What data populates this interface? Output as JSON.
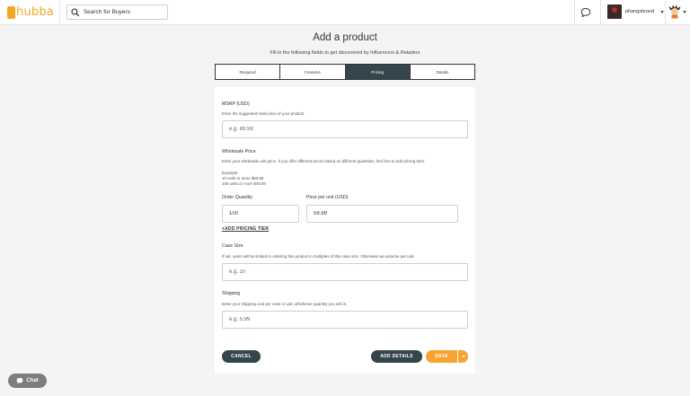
{
  "header": {
    "logo_text": "hubba",
    "search_placeholder": "Search for Buyers",
    "username": "phangsbrand"
  },
  "page": {
    "title": "Add a product",
    "subtitle": "Fill in the following fields to get discovered by Influencers & Retailers"
  },
  "tabs": [
    {
      "label": "Required",
      "active": false
    },
    {
      "label": "Features",
      "active": false
    },
    {
      "label": "Pricing",
      "active": true
    },
    {
      "label": "Details",
      "active": false
    }
  ],
  "form": {
    "msrp": {
      "label": "MSRP (USD)",
      "help": "Enter the suggested retail price of your product.",
      "placeholder": "e.g. 89.99"
    },
    "wholesale": {
      "label": "Wholesale Price",
      "help": "Enter your wholesale unit price. If you offer different prices based on different quantities, feel free to add pricing tiers.",
      "example_title": "Example:",
      "example_line1": "10 units or more $59.99",
      "example_line2": "100 units or more $49.99",
      "quantity_label": "Order Quantity",
      "quantity_value": "100",
      "price_label": "Price per unit (USD)",
      "price_value": "59.99",
      "add_tier_label": "+ADD PRICING TIER"
    },
    "case_size": {
      "label": "Case Size",
      "help": "If set, users will be limited to ordering this product in multiples of this case size. Otherwise we assume per unit.",
      "placeholder": "e.g. 10"
    },
    "shipping": {
      "label": "Shipping",
      "help": "Enter your shipping cost per case or unit, whichever quantity you sell in.",
      "placeholder": "e.g. 5.99"
    }
  },
  "actions": {
    "cancel_label": "CANCEL",
    "add_details_label": "ADD DETAILS",
    "save_label": "SAVE"
  },
  "chat": {
    "label": "Chat"
  },
  "colors": {
    "brand": "#f5a623",
    "dark": "#34464b",
    "accent": "#f7a331"
  }
}
